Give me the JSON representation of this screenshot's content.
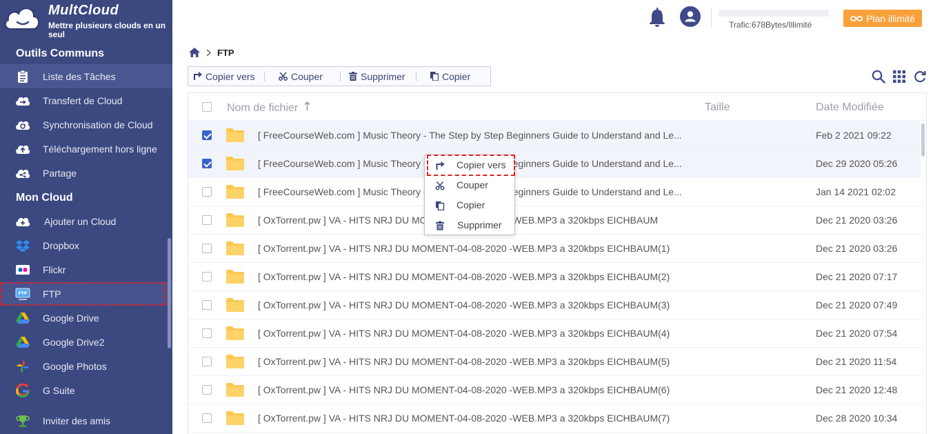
{
  "brand": {
    "name": "MultCloud",
    "tagline": "Mettre plusieurs clouds en un seul"
  },
  "sidebar": {
    "section_common": "Outils Communs",
    "common_items": [
      {
        "label": "Liste des Tâches",
        "icon": "clipboard-icon"
      },
      {
        "label": "Transfert de Cloud",
        "icon": "cloud-transfer-icon"
      },
      {
        "label": "Synchronisation de Cloud",
        "icon": "cloud-sync-icon"
      },
      {
        "label": "Téléchargement hors ligne",
        "icon": "cloud-upload-icon"
      },
      {
        "label": "Partage",
        "icon": "cloud-share-icon"
      }
    ],
    "section_cloud": "Mon Cloud",
    "cloud_items": [
      {
        "label": "Ajouter un Cloud",
        "icon": "cloud-add-icon"
      },
      {
        "label": "Dropbox",
        "icon": "dropbox-icon"
      },
      {
        "label": "Flickr",
        "icon": "flickr-icon"
      },
      {
        "label": "FTP",
        "icon": "ftp-icon"
      },
      {
        "label": "Google Drive",
        "icon": "google-drive-icon"
      },
      {
        "label": "Google Drive2",
        "icon": "google-drive-icon"
      },
      {
        "label": "Google Photos",
        "icon": "google-photos-icon"
      },
      {
        "label": "G Suite",
        "icon": "g-suite-icon"
      }
    ],
    "invite": "Inviter des amis"
  },
  "topbar": {
    "trafic": "Trafic:678Bytes/Illimité",
    "plan": "Plan illimité"
  },
  "breadcrumb": {
    "current": "FTP"
  },
  "toolbar": {
    "copy_to": "Copier vers",
    "cut": "Couper",
    "delete": "Supprimer",
    "copy": "Copier"
  },
  "table": {
    "col_name": "Nom de fichier",
    "col_size": "Taille",
    "col_date": "Date Modifiée",
    "rows": [
      {
        "name": "[ FreeCourseWeb.com ] Music Theory - The Step by Step Beginners Guide to Understand and Le...",
        "date": "Feb 2 2021 09:22",
        "checked": true
      },
      {
        "name": "[ FreeCourseWeb.com ] Music Theory - The Step by Step Beginners Guide to Understand and Le...",
        "date": "Dec 29 2020 05:26",
        "checked": true
      },
      {
        "name": "[ FreeCourseWeb.com ] Music Theory - The Step by Step Beginners Guide to Understand and Le...",
        "date": "Jan 14 2021 02:02",
        "checked": false
      },
      {
        "name": "[ OxTorrent.pw ] VA - HITS NRJ DU MOMENT-04-08-2020 -WEB.MP3 a 320kbps EICHBAUM",
        "date": "Dec 21 2020 03:26",
        "checked": false
      },
      {
        "name": "[ OxTorrent.pw ] VA - HITS NRJ DU MOMENT-04-08-2020 -WEB.MP3 a 320kbps EICHBAUM(1)",
        "date": "Dec 21 2020 03:26",
        "checked": false
      },
      {
        "name": "[ OxTorrent.pw ] VA - HITS NRJ DU MOMENT-04-08-2020 -WEB.MP3 a 320kbps EICHBAUM(2)",
        "date": "Dec 21 2020 07:17",
        "checked": false
      },
      {
        "name": "[ OxTorrent.pw ] VA - HITS NRJ DU MOMENT-04-08-2020 -WEB.MP3 a 320kbps EICHBAUM(3)",
        "date": "Dec 21 2020 07:49",
        "checked": false
      },
      {
        "name": "[ OxTorrent.pw ] VA - HITS NRJ DU MOMENT-04-08-2020 -WEB.MP3 a 320kbps EICHBAUM(4)",
        "date": "Dec 21 2020 07:54",
        "checked": false
      },
      {
        "name": "[ OxTorrent.pw ] VA - HITS NRJ DU MOMENT-04-08-2020 -WEB.MP3 a 320kbps EICHBAUM(5)",
        "date": "Dec 21 2020 11:54",
        "checked": false
      },
      {
        "name": "[ OxTorrent.pw ] VA - HITS NRJ DU MOMENT-04-08-2020 -WEB.MP3 a 320kbps EICHBAUM(6)",
        "date": "Dec 21 2020 12:48",
        "checked": false
      },
      {
        "name": "[ OxTorrent.pw ] VA - HITS NRJ DU MOMENT-04-08-2020 -WEB.MP3 a 320kbps EICHBAUM(7)",
        "date": "Dec 28 2020 10:34",
        "checked": false
      }
    ]
  },
  "context_menu": {
    "items": [
      {
        "label": "Copier vers",
        "icon": "copy-to-icon"
      },
      {
        "label": "Couper",
        "icon": "scissors-icon"
      },
      {
        "label": "Copier",
        "icon": "copy-icon"
      },
      {
        "label": "Supprimer",
        "icon": "trash-icon"
      }
    ]
  },
  "colors": {
    "sidebar": "#3c4880",
    "accent": "#3a62c8",
    "plan": "#f9a03a",
    "highlight": "#e02020",
    "folder": "#fcc854"
  }
}
